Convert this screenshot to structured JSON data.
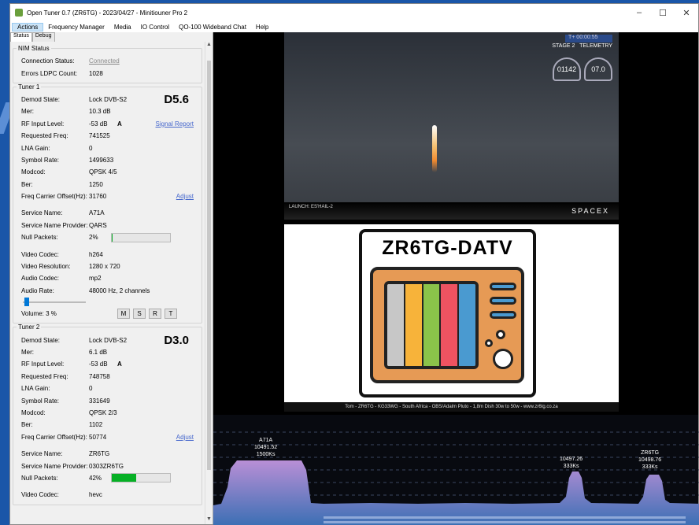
{
  "window": {
    "title": "Open Tuner 0.7 (ZR6TG) - 2023/04/27 - Minitiouner Pro 2",
    "minimize": "–",
    "maximize": "☐",
    "close": "✕"
  },
  "menu": [
    "Actions",
    "Frequency Manager",
    "Media",
    "IO Control",
    "QO-100 Wideband Chat",
    "Help"
  ],
  "tabs": [
    "Status",
    "Debug"
  ],
  "nim": {
    "title": "NIM Status",
    "connection_label": "Connection Status:",
    "connection_value": "Connected",
    "errors_label": "Errors LDPC Count:",
    "errors_value": "1028"
  },
  "tuner1": {
    "title": "Tuner 1",
    "tag": "D5.6",
    "demod_label": "Demod State:",
    "demod_value": "Lock DVB-S2",
    "mer_label": "Mer:",
    "mer_value": "10.3 dB",
    "rf_label": "RF Input Level:",
    "rf_value": "-53 dB",
    "rf_flag": "A",
    "signal_report": "Signal Report",
    "req_label": "Requested Freq:",
    "req_value": "741525",
    "lna_label": "LNA Gain:",
    "lna_value": "0",
    "sr_label": "Symbol Rate:",
    "sr_value": "1499633",
    "modcod_label": "Modcod:",
    "modcod_value": "QPSK 4/5",
    "ber_label": "Ber:",
    "ber_value": "1250",
    "offset_label": "Freq Carrier Offset(Hz):",
    "offset_value": "31760",
    "adjust": "Adjust",
    "service_label": "Service Name:",
    "service_value": "A71A",
    "provider_label": "Service Name Provider:",
    "provider_value": "QARS",
    "null_label": "Null Packets:",
    "null_value": "2%",
    "null_fraction": 0.02,
    "vcodec_label": "Video Codec:",
    "vcodec_value": "h264",
    "vres_label": "Video Resolution:",
    "vres_value": "1280 x 720",
    "acodec_label": "Audio Codec:",
    "acodec_value": "mp2",
    "arate_label": "Audio Rate:",
    "arate_value": "48000 Hz, 2 channels",
    "volume_label": "Volume: 3 %",
    "volume_fraction": 0.03,
    "buttons": [
      "M",
      "S",
      "R",
      "T"
    ]
  },
  "tuner2": {
    "title": "Tuner 2",
    "tag": "D3.0",
    "demod_label": "Demod State:",
    "demod_value": "Lock DVB-S2",
    "mer_label": "Mer:",
    "mer_value": "6.1 dB",
    "rf_label": "RF Input Level:",
    "rf_value": "-53 dB",
    "rf_flag": "A",
    "req_label": "Requested Freq:",
    "req_value": "748758",
    "lna_label": "LNA Gain:",
    "lna_value": "0",
    "sr_label": "Symbol Rate:",
    "sr_value": "331649",
    "modcod_label": "Modcod:",
    "modcod_value": "QPSK 2/3",
    "ber_label": "Ber:",
    "ber_value": "1102",
    "offset_label": "Freq Carrier Offset(Hz):",
    "offset_value": "50774",
    "adjust": "Adjust",
    "service_label": "Service Name:",
    "service_value": "ZR6TG",
    "provider_label": "Service Name Provider:",
    "provider_value": "0303ZR6TG",
    "null_label": "Null Packets:",
    "null_value": "42%",
    "null_fraction": 0.42,
    "vcodec_label": "Video Codec:",
    "vcodec_value": "hevc"
  },
  "video1": {
    "timer": "T+ 00:00:55",
    "stage": "STAGE 2",
    "telemetry": "TELEMETRY",
    "speed_value": "01142",
    "altitude_value": "07.0",
    "launch": "LAUNCH: ES'HAIL-2",
    "brand": "SPACEX"
  },
  "video2": {
    "logo_title": "ZR6TG-DATV",
    "caption": "Tom - ZR6TG - KG33WG - South Africa - OBS/Adalm Pluto - 1,8m Dish 30w to 50w - www.zr6tg.co.za"
  },
  "spectrum": {
    "signals": [
      {
        "callsign": "A71A",
        "freq": "10491.52",
        "rate": "1500Ks"
      },
      {
        "callsign": "",
        "freq": "10497.26",
        "rate": "333Ks"
      },
      {
        "callsign": "ZR6TG",
        "freq": "10498.76",
        "rate": "333Ks"
      }
    ]
  },
  "colors": {
    "accent": "#0078d7",
    "meter_fill": "#06b025",
    "spectrum_top": "#b98fd6",
    "spectrum_bottom": "#3b6fb4"
  }
}
